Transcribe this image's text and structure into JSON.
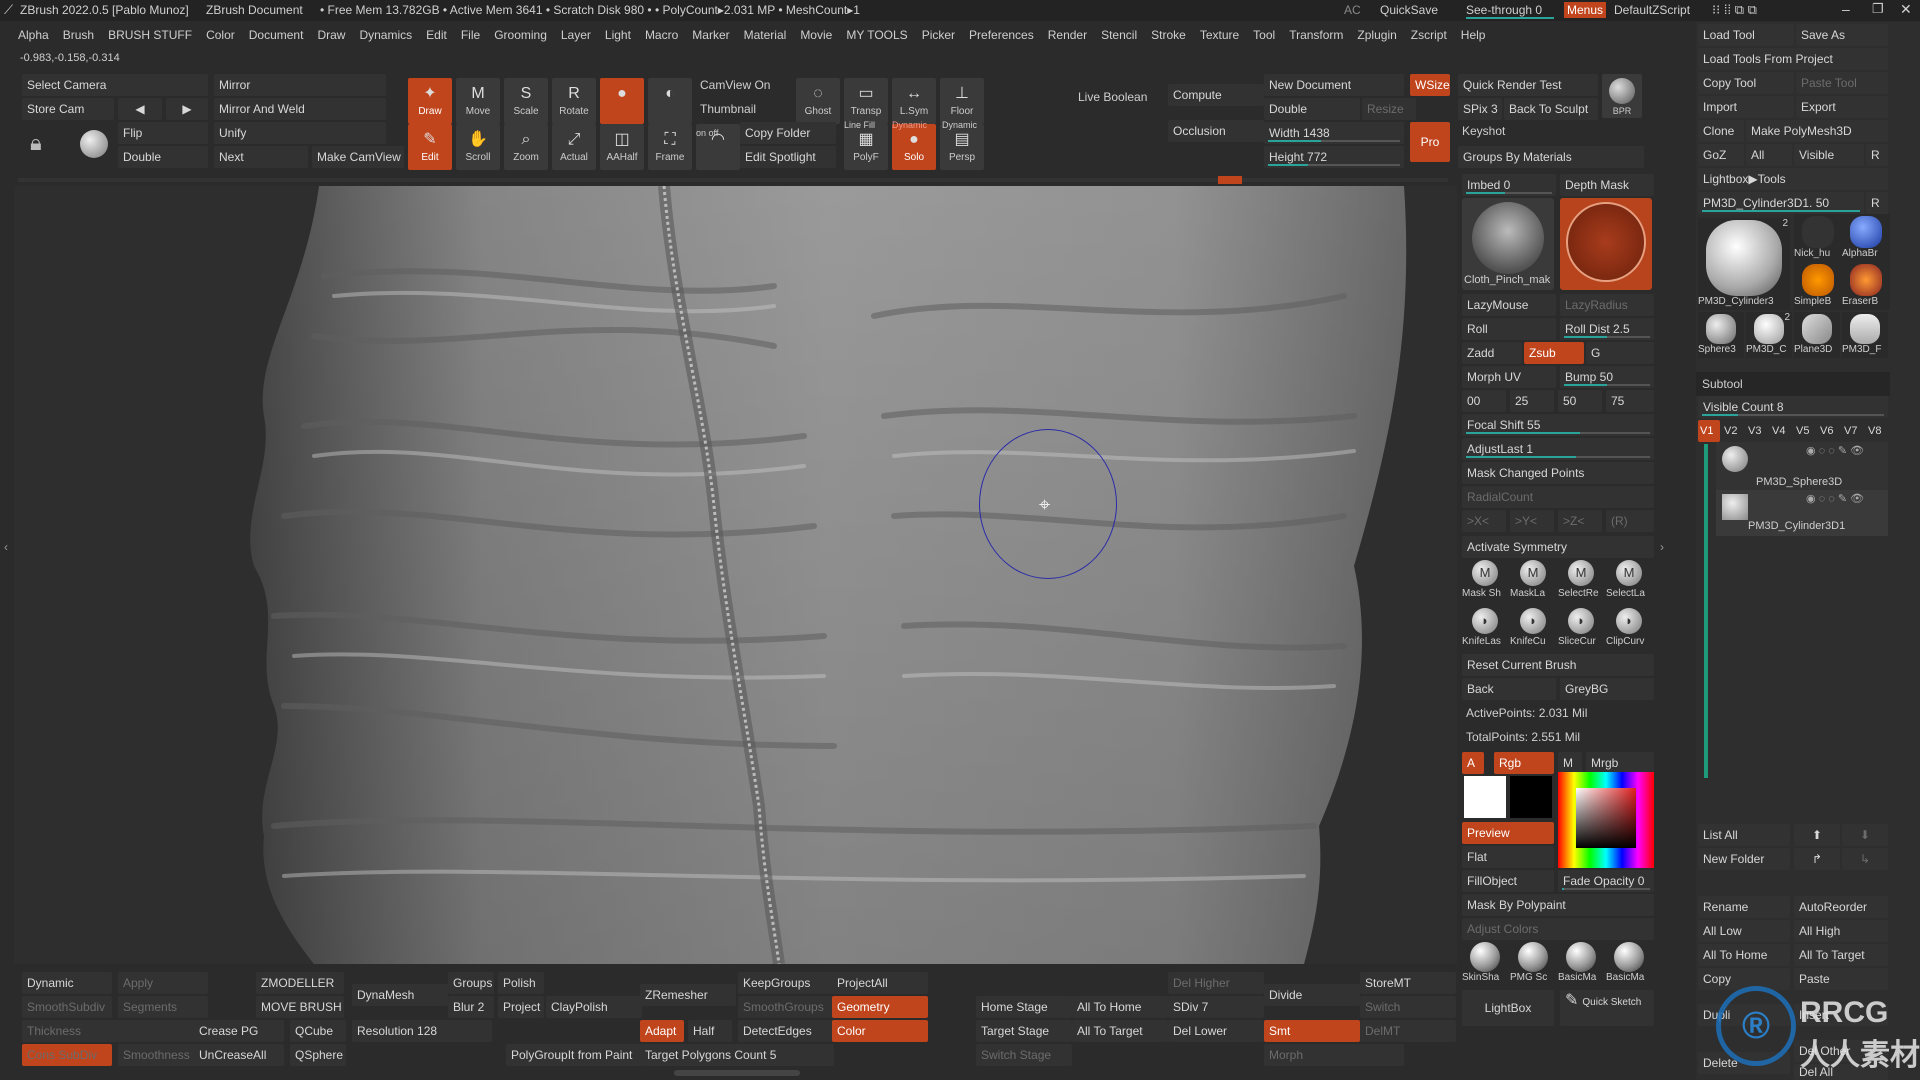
{
  "titlebar": {
    "app": "ZBrush 2022.0.5 [Pablo Munoz]",
    "doc": "ZBrush Document",
    "stats": "• Free Mem 13.782GB • Active Mem 3641 • Scratch Disk 980 • • PolyCount▸2.031 MP • MeshCount▸1",
    "ac": "AC",
    "quicksave": "QuickSave",
    "seethrough": "See-through 0",
    "menus": "Menus",
    "zscript": "DefaultZScript"
  },
  "menu": [
    "Alpha",
    "Brush",
    "BRUSH STUFF",
    "Color",
    "Document",
    "Draw",
    "Dynamics",
    "Edit",
    "File",
    "Grooming",
    "Layer",
    "Light",
    "Macro",
    "Marker",
    "Material",
    "Movie",
    "MY TOOLS",
    "Picker",
    "Preferences",
    "Render",
    "Stencil",
    "Stroke",
    "Texture",
    "Tool",
    "Transform",
    "Zplugin",
    "Zscript",
    "Help"
  ],
  "coords": "-0.983,-0.158,-0.314",
  "shelf": {
    "select_camera": "Select Camera",
    "mirror": "Mirror",
    "store_cam": "Store Cam",
    "mirror_weld": "Mirror And Weld",
    "flip": "Flip",
    "unify": "Unify",
    "double": "Double",
    "next": "Next",
    "make_camview": "Make CamView",
    "camview_on": "CamView On",
    "thumbnail": "Thumbnail",
    "copy_folder": "Copy Folder",
    "edit_spotlight": "Edit Spotlight",
    "live_boolean": "Live Boolean",
    "compute": "Compute",
    "occlusion": "Occlusion",
    "new_document": "New Document",
    "wsize": "WSize",
    "double2": "Double",
    "resize": "Resize",
    "width": "Width 1438",
    "height": "Height 772",
    "pro": "Pro",
    "quick_render": "Quick Render Test",
    "spix": "SPix 3",
    "back_to_sculpt": "Back To Sculpt",
    "bpr": "BPR",
    "keyshot": "Keyshot",
    "groups_by_mat": "Groups By Materials"
  },
  "tools": [
    {
      "label": "Draw",
      "icon": "✦"
    },
    {
      "label": "Move",
      "icon": "M"
    },
    {
      "label": "Scale",
      "icon": "S"
    },
    {
      "label": "Rotate",
      "icon": "R"
    },
    {
      "label": "",
      "icon": "●"
    },
    {
      "label": "",
      "icon": "◐"
    },
    {
      "label": "Ghost",
      "icon": "◌"
    },
    {
      "label": "Transp",
      "icon": "▭"
    },
    {
      "label": "L.Sym",
      "icon": "↔"
    },
    {
      "label": "Floor",
      "icon": "⊥"
    },
    {
      "label": "Edit",
      "icon": "✎"
    },
    {
      "label": "Scroll",
      "icon": "✋"
    },
    {
      "label": "Zoom",
      "icon": "⌕"
    },
    {
      "label": "Actual",
      "icon": "⤢"
    },
    {
      "label": "AAHalf",
      "icon": "◫"
    },
    {
      "label": "Frame",
      "icon": "⛶"
    },
    {
      "label": "",
      "icon": "◠"
    },
    {
      "label": "PolyF",
      "icon": "▦"
    },
    {
      "label": "Solo",
      "icon": "●"
    },
    {
      "label": "Persp",
      "icon": "▤"
    }
  ],
  "tool_small": {
    "linefill": "Line Fill",
    "dynamic": "Dynamic",
    "dynamic2": "Dynamic",
    "onoff": "on  off"
  },
  "brushpanel": {
    "imbed": "Imbed 0",
    "depth_mask": "Depth Mask",
    "brush_name": "Cloth_Pinch_mak",
    "lazymouse": "LazyMouse",
    "lazyradius": "LazyRadius",
    "roll": "Roll",
    "roll_dist": "Roll Dist 2.5",
    "zadd": "Zadd",
    "zsub": "Zsub",
    "g": "G",
    "morph_uv": "Morph UV",
    "bump": "Bump 50",
    "b00": "00",
    "b25": "25",
    "b50": "50",
    "b75": "75",
    "focal": "Focal Shift 55",
    "adjustlast": "AdjustLast 1",
    "mask_changed": "Mask Changed Points",
    "radialcount": "RadialCount",
    "sym_x": ">X<",
    "sym_y": ">Y<",
    "sym_z": ">Z<",
    "sym_r": "(R)",
    "activate_sym": "Activate Symmetry",
    "masks": [
      "Mask Sh",
      "MaskLa",
      "SelectRe",
      "SelectLa"
    ],
    "knives": [
      "KnifeLas",
      "KnifeCu",
      "SliceCur",
      "ClipCurv"
    ],
    "reset_brush": "Reset Current Brush",
    "back": "Back",
    "greybg": "GreyBG",
    "active_points": "ActivePoints: 2.031 Mil",
    "total_points": "TotalPoints: 2.551 Mil",
    "a": "A",
    "rgb": "Rgb",
    "m": "M",
    "mrgb": "Mrgb",
    "preview": "Preview",
    "flat": "Flat",
    "fillobject": "FillObject",
    "fade_opacity": "Fade Opacity 0",
    "mask_polypaint": "Mask By Polypaint",
    "adjust_colors": "Adjust Colors",
    "materials": [
      "SkinSha",
      "PMG Sc",
      "BasicMa",
      "BasicMa"
    ],
    "lightbox": "LightBox",
    "quick_sketch": "Quick Sketch"
  },
  "toolpanel": {
    "load_tool": "Load Tool",
    "save_as": "Save As",
    "load_project": "Load Tools From Project",
    "copy_tool": "Copy Tool",
    "paste_tool": "Paste Tool",
    "import": "Import",
    "export": "Export",
    "clone": "Clone",
    "make_polymesh": "Make PolyMesh3D",
    "goz": "GoZ",
    "all": "All",
    "visible": "Visible",
    "r": "R",
    "lightbox_tools": "Lightbox▶Tools",
    "current": "PM3D_Cylinder3D1. 50",
    "r2": "R",
    "thumbs": [
      {
        "label": "PM3D_Cylinder3",
        "badge": "2"
      },
      {
        "label": "Nick_hu",
        "badge": ""
      },
      {
        "label": "AlphaBr",
        "badge": ""
      },
      {
        "label": "SimpleB",
        "badge": ""
      },
      {
        "label": "EraserB",
        "badge": ""
      },
      {
        "label": "Sphere3",
        "badge": ""
      },
      {
        "label": "PM3D_C",
        "badge": "2"
      },
      {
        "label": "Plane3D",
        "badge": ""
      },
      {
        "label": "PM3D_F",
        "badge": ""
      }
    ],
    "subtool": "Subtool",
    "visible_count": "Visible Count 8",
    "versions": [
      "V1",
      "V2",
      "V3",
      "V4",
      "V5",
      "V6",
      "V7",
      "V8"
    ],
    "subtools": [
      "PM3D_Sphere3D",
      "PM3D_Cylinder3D1"
    ],
    "list_all": "List All",
    "new_folder": "New Folder",
    "rename": "Rename",
    "autoreorder": "AutoReorder",
    "all_low": "All Low",
    "all_high": "All High",
    "all_to_home": "All To Home",
    "all_to_target": "All To Target",
    "copy": "Copy",
    "paste": "Paste",
    "duplicate": "Dupli",
    "insert": "Insert",
    "delete": "Delete",
    "del_other": "Del Other",
    "del_all": "Del All"
  },
  "bottom": {
    "dynamic": "Dynamic",
    "apply": "Apply",
    "smoothsubdiv": "SmoothSubdiv",
    "segments": "Segments",
    "thickness": "Thickness",
    "constsubdiv": "Cons SubDiv",
    "smoothness": "Smoothness",
    "zmodeller": "ZMODELLER",
    "move_brush": "MOVE BRUSH",
    "crease_pg": "Crease PG",
    "uncreaseall": "UnCreaseAll",
    "qcube": "QCube",
    "qsphere": "QSphere",
    "dynamesh": "DynaMesh",
    "groups": "Groups",
    "polish": "Polish",
    "blur": "Blur 2",
    "project": "Project",
    "claypolish": "ClayPolish",
    "resolution": "Resolution 128",
    "polygroupit": "PolyGroupIt from Paint",
    "zremesher": "ZRemesher",
    "keepgroups": "KeepGroups",
    "smoothgroups": "SmoothGroups",
    "adapt": "Adapt",
    "half": "Half",
    "detectedges": "DetectEdges",
    "target_polys": "Target Polygons Count 5",
    "projectall": "ProjectAll",
    "geometry": "Geometry",
    "color": "Color",
    "home_stage": "Home Stage",
    "all_to_home": "All To Home",
    "target_stage": "Target Stage",
    "all_to_target": "All To Target",
    "switch_stage": "Switch Stage",
    "del_higher": "Del Higher",
    "sdiv": "SDiv 7",
    "del_lower": "Del Lower",
    "divide": "Divide",
    "smt": "Smt",
    "storemt": "StoreMT",
    "switch": "Switch",
    "delmt": "DelMT",
    "morph": "Morph"
  },
  "watermark": "RRCG 人人素材"
}
